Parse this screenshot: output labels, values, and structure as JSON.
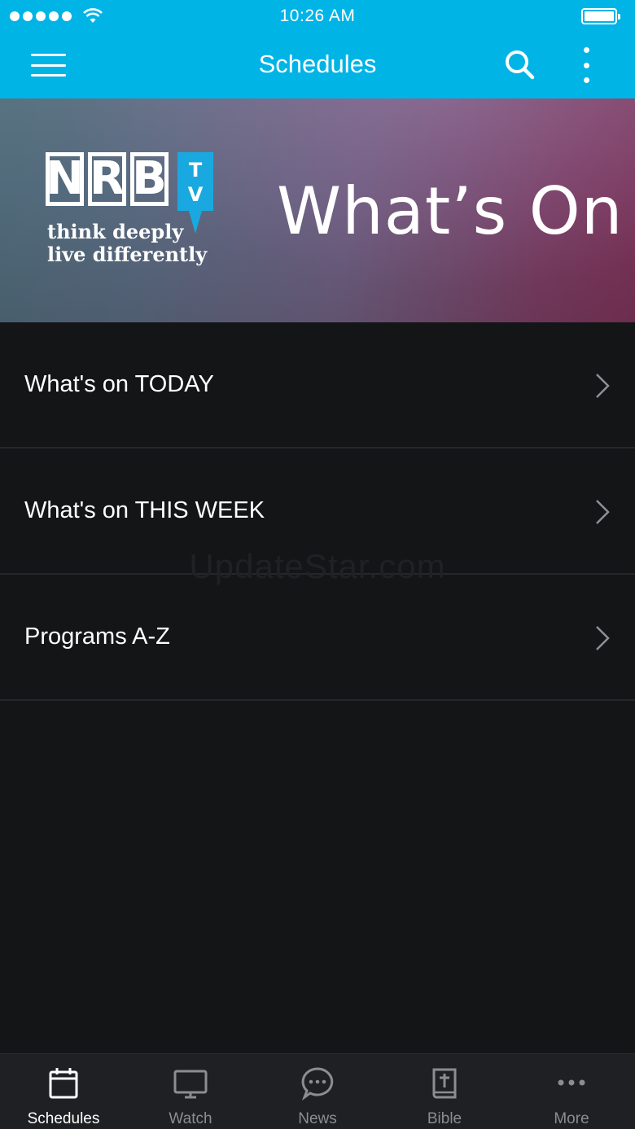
{
  "status_bar": {
    "time": "10:26 AM",
    "battery_level": 1.0
  },
  "nav": {
    "title": "Schedules"
  },
  "banner": {
    "logo_text": "NRB",
    "logo_tv": "TV",
    "tagline_line1": "think deeply",
    "tagline_line2": "live differently",
    "title": "What’s On"
  },
  "menu": {
    "items": [
      {
        "label": "What's on TODAY"
      },
      {
        "label": "What's on THIS WEEK"
      },
      {
        "label": "Programs A-Z"
      }
    ]
  },
  "watermark": "UpdateStar.com",
  "tabs": [
    {
      "label": "Schedules",
      "icon": "calendar-icon",
      "active": true
    },
    {
      "label": "Watch",
      "icon": "tv-icon",
      "active": false
    },
    {
      "label": "News",
      "icon": "chat-bubble-icon",
      "active": false
    },
    {
      "label": "Bible",
      "icon": "bible-icon",
      "active": false
    },
    {
      "label": "More",
      "icon": "ellipsis-icon",
      "active": false
    }
  ],
  "colors": {
    "accent": "#00b4e6",
    "background": "#141517",
    "tab_bar": "#1e2023"
  }
}
